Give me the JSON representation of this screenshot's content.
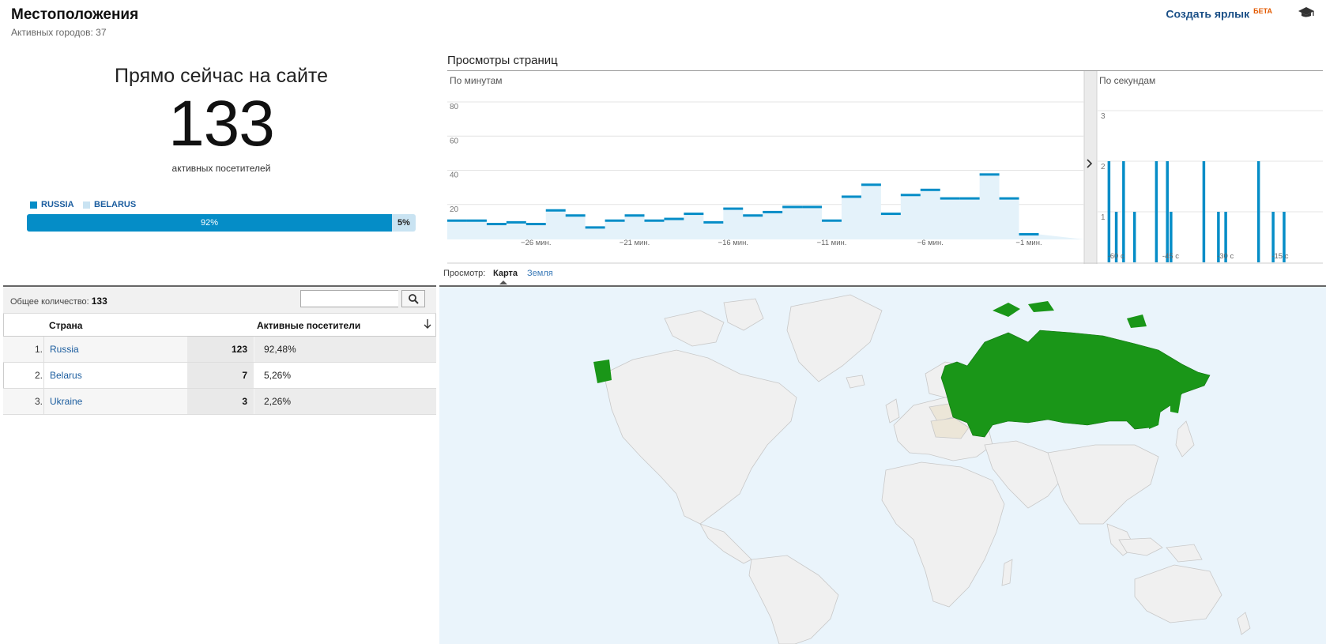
{
  "header": {
    "title": "Местоположения",
    "subtitle": "Активных городов: 37",
    "shortcut_label": "Создать ярлык",
    "beta_badge": "БЕТА",
    "help_icon": "graduation-cap-icon"
  },
  "summary": {
    "title": "Прямо сейчас на сайте",
    "count": "133",
    "label": "активных посетителей",
    "legend": [
      {
        "name": "RUSSIA",
        "color": "#058dc7"
      },
      {
        "name": "BELARUS",
        "color": "#c9e3f2"
      }
    ],
    "share": [
      {
        "label": "92%",
        "value": 92
      },
      {
        "label": "5%",
        "value": 5
      }
    ]
  },
  "pageviews": {
    "title": "Просмотры страниц",
    "per_minute_label": "По минутам",
    "per_second_label": "По секундам",
    "expand_icon": "chevron-right-icon"
  },
  "chart_data": [
    {
      "type": "area",
      "title": "По минутам",
      "y_ticks": [
        "80",
        "60",
        "40",
        "20"
      ],
      "ylim": [
        0,
        80
      ],
      "x_tick_labels": [
        "−26 мин.",
        "−21 мин.",
        "−16 мин.",
        "−11 мин.",
        "−6 мин.",
        "−1 мин."
      ],
      "values": [
        11,
        11,
        9,
        10,
        9,
        17,
        14,
        7,
        11,
        14,
        11,
        12,
        15,
        10,
        18,
        14,
        16,
        19,
        19,
        11,
        25,
        32,
        15,
        26,
        29,
        24,
        24,
        38,
        24,
        3
      ],
      "color": "#058dc7",
      "grid": true
    },
    {
      "type": "bar",
      "title": "По секундам",
      "y_ticks": [
        "3",
        "2",
        "1"
      ],
      "ylim": [
        0,
        3
      ],
      "x_tick_labels": [
        "-60 с",
        "-45 с",
        "-30 с",
        "-15 с"
      ],
      "values": [
        2,
        1,
        2,
        1,
        2,
        2,
        1,
        2,
        1,
        1,
        2,
        1,
        1
      ],
      "color": "#058dc7",
      "grid": true
    }
  ],
  "view_switch": {
    "label": "Просмотр:",
    "map": "Карта",
    "earth": "Земля"
  },
  "map": {
    "ocean_color": "#eaf4fb",
    "land_color": "#f0f0f0",
    "highlight_color": "#1a9618",
    "minor_color": "#ece6d8"
  },
  "table": {
    "total_label": "Общее количество:",
    "total_value": "133",
    "search_placeholder": "",
    "search_icon": "search-icon",
    "col_country": "Страна",
    "col_visitors": "Активные посетители",
    "sort_icon": "sort-down-icon",
    "rows": [
      {
        "num": "1.",
        "country": "Russia",
        "value": "123",
        "pct": "92,48%"
      },
      {
        "num": "2.",
        "country": "Belarus",
        "value": "7",
        "pct": "5,26%"
      },
      {
        "num": "3.",
        "country": "Ukraine",
        "value": "3",
        "pct": "2,26%"
      }
    ]
  }
}
